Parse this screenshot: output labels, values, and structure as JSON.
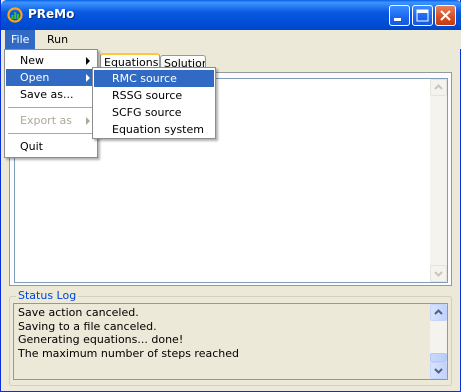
{
  "window": {
    "title": "PReMo"
  },
  "menubar": {
    "file": "File",
    "run": "Run"
  },
  "tabs": [
    {
      "label": "Equations"
    },
    {
      "label": "Solution"
    }
  ],
  "file_menu": {
    "new": "New",
    "open": "Open",
    "save_as": "Save as...",
    "export_as": "Export as",
    "quit": "Quit"
  },
  "open_submenu": {
    "items": [
      "RMC source",
      "RSSG source",
      "SCFG source",
      "Equation system"
    ],
    "highlighted": "RMC source"
  },
  "status_log": {
    "label": "Status Log",
    "lines": [
      "Save action canceled.",
      "Saving to a file canceled.",
      "Generating equations... done!",
      "The maximum number of steps reached"
    ]
  },
  "colors": {
    "titlebar": "#0054e3",
    "selection": "#316ac5",
    "legend": "#0046d5",
    "tab_accent": "#ffc83c"
  }
}
